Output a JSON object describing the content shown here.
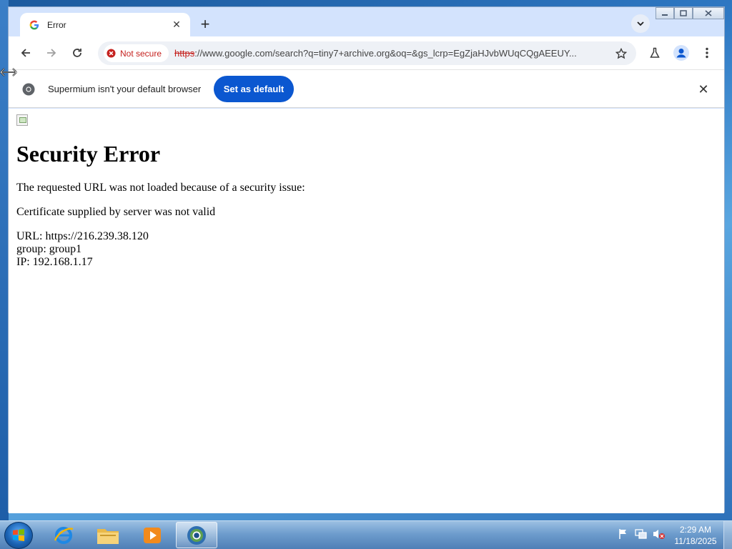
{
  "tab": {
    "title": "Error",
    "close_glyph": "✕",
    "new_tab_glyph": "+"
  },
  "omnibox": {
    "security_label": "Not secure",
    "url_scheme": "https",
    "url_rest": "://www.google.com/search?q=tiny7+archive.org&oq=&gs_lcrp=EgZjaHJvbWUqCQgAEEUY..."
  },
  "infobar": {
    "message": "Supermium isn't your default browser",
    "button_label": "Set as default",
    "close_glyph": "✕"
  },
  "page": {
    "heading": "Security Error",
    "paragraph1": "The requested URL was not loaded because of a security issue:",
    "paragraph2": "Certificate supplied by server was not valid",
    "url_line": "URL: https://216.239.38.120",
    "group_line": "group: group1",
    "ip_line": "IP: 192.168.1.17"
  },
  "taskbar": {
    "clock_time": "2:29 AM",
    "clock_date": "11/18/2025",
    "apps": [
      "internet-explorer",
      "file-explorer",
      "media-player",
      "supermium"
    ]
  },
  "colors": {
    "accent": "#0b57d0",
    "danger": "#c5221f",
    "tab_strip": "#d3e3fd"
  }
}
